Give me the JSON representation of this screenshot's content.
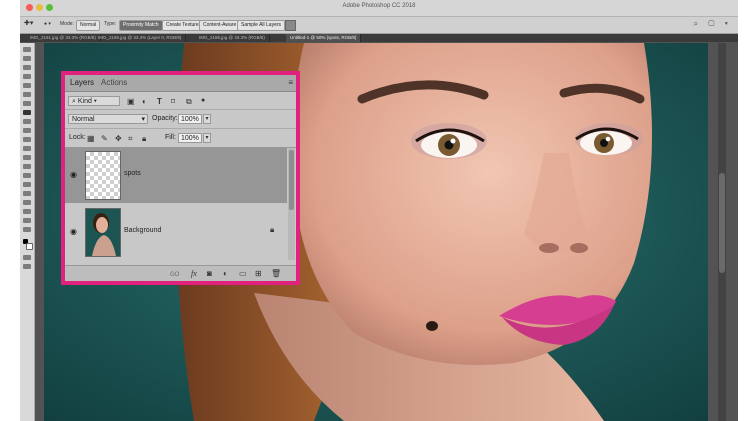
{
  "window": {
    "title": "Adobe Photoshop CC 2018"
  },
  "options_bar": {
    "mode_label": "Mode:",
    "mode_value": "Normal",
    "type_label": "Type:",
    "proximity_match": "Proximity Match",
    "create_texture": "Create Texture",
    "content_aware": "Content-Aware",
    "sample_all_layers": "Sample All Layers",
    "right_icons": "⌕ ▢ ▾"
  },
  "document_tabs": [
    "IMG_2181.jpg @ 33.3% (RGB/8)",
    "IMG_2185.jpg @ 33.3% (Layer 0, RGB/8)",
    "IMG_2186.jpg @ 33.3% (RGB/8)",
    "Untitled-1 @ 50% (spots, RGB/8)"
  ],
  "layers_panel": {
    "tabs": [
      "Layers",
      "Actions"
    ],
    "menu_icon": "≡",
    "filter_kind": "Kind",
    "filter_icons": [
      "image-icon",
      "adjustment-icon",
      "type-icon",
      "shape-icon",
      "smart-object-icon"
    ],
    "blend_mode": "Normal",
    "opacity_label": "Opacity:",
    "opacity_value": "100%",
    "lock_label": "Lock:",
    "fill_label": "Fill:",
    "fill_value": "100%",
    "layers": [
      {
        "name": "spots",
        "selected": true,
        "visible": true,
        "transparent": true
      },
      {
        "name": "Background",
        "selected": false,
        "visible": true,
        "locked": true
      }
    ],
    "footer_icons": [
      "link-icon",
      "fx-icon",
      "mask-icon",
      "adjustment-icon",
      "folder-icon",
      "new-layer-icon",
      "trash-icon"
    ],
    "footer_fx": "fx"
  },
  "colors": {
    "highlight": "#e0217e",
    "canvas_bg": "#1e5c5b",
    "lip": "#d63f91"
  }
}
